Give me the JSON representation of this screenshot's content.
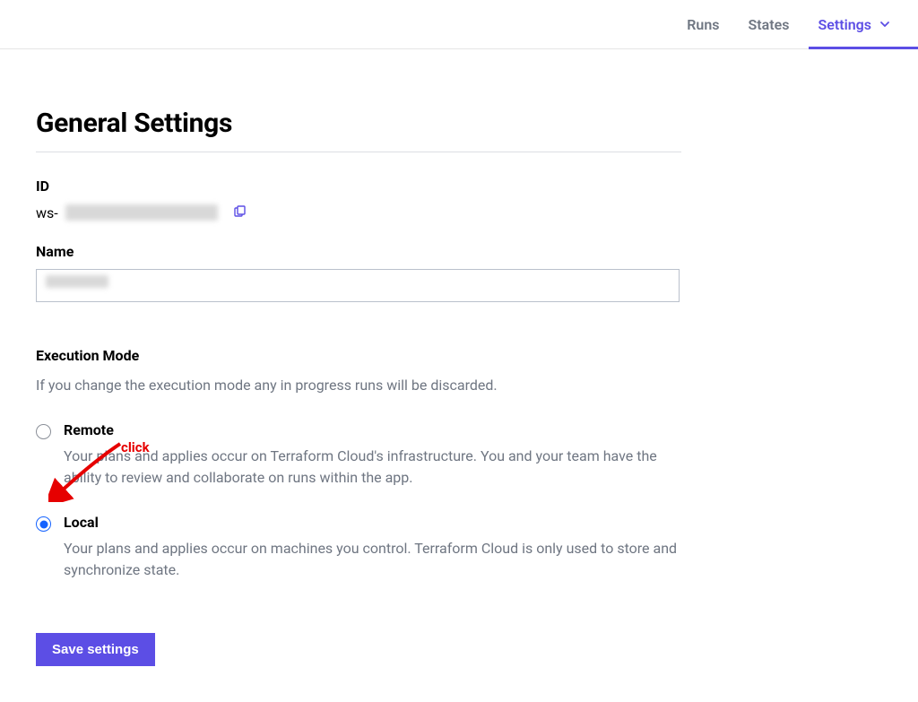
{
  "nav": {
    "tabs": [
      {
        "label": "Runs"
      },
      {
        "label": "States"
      },
      {
        "label": "Settings",
        "active": true,
        "has_dropdown": true
      }
    ]
  },
  "page": {
    "title": "General Settings",
    "id_label": "ID",
    "id_prefix": "ws-",
    "name_label": "Name",
    "execution": {
      "section_label": "Execution Mode",
      "help_text": "If you change the execution mode any in progress runs will be discarded.",
      "options": [
        {
          "key": "remote",
          "title": "Remote",
          "desc": "Your plans and applies occur on Terraform Cloud's infrastructure. You and your team have the ability to review and collaborate on runs within the app.",
          "selected": false
        },
        {
          "key": "local",
          "title": "Local",
          "desc": "Your plans and applies occur on machines you control. Terraform Cloud is only used to store and synchronize state.",
          "selected": true
        }
      ]
    },
    "save_button_label": "Save settings"
  },
  "annotation": {
    "click_text": "click"
  }
}
